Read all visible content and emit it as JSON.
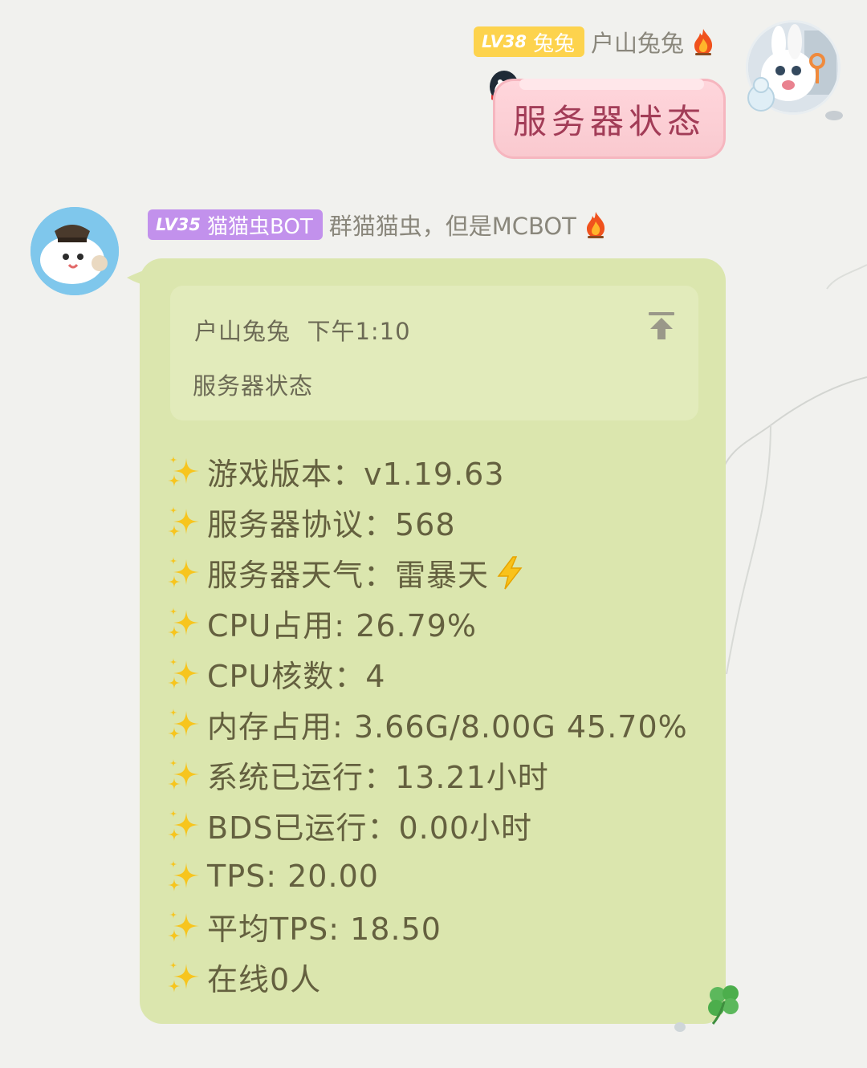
{
  "messages": [
    {
      "side": "right",
      "level": "LV38",
      "title": "兔兔",
      "sender": "户山兔兔",
      "text": "服务器状态"
    },
    {
      "side": "left",
      "level": "LV35",
      "title": "猫猫虫BOT",
      "sender": "群猫猫虫，但是MCBOT",
      "reply": {
        "author": "户山兔兔",
        "time": "下午1:10",
        "text": "服务器状态"
      },
      "lines": [
        "游戏版本：v1.19.63",
        "服务器协议：568",
        "服务器天气：雷暴天",
        "CPU占用: 26.79%",
        "CPU核数：4",
        "内存占用: 3.66G/8.00G 45.70%",
        "系统已运行：13.21小时",
        "BDS已运行：0.00小时",
        "TPS: 20.00",
        "平均TPS: 18.50",
        "在线0人"
      ]
    }
  ],
  "icons": {
    "sparkle": "sparkles-icon",
    "fire": "fire-icon",
    "bolt": "lightning-bolt-icon",
    "jump": "jump-to-message-icon",
    "clover": "four-leaf-clover-icon"
  },
  "colors": {
    "bot_bubble": "#dbe6ae",
    "user_bubble": "#f9c9cf",
    "badge_user": "#fdd34d",
    "badge_bot": "#c291ec"
  }
}
